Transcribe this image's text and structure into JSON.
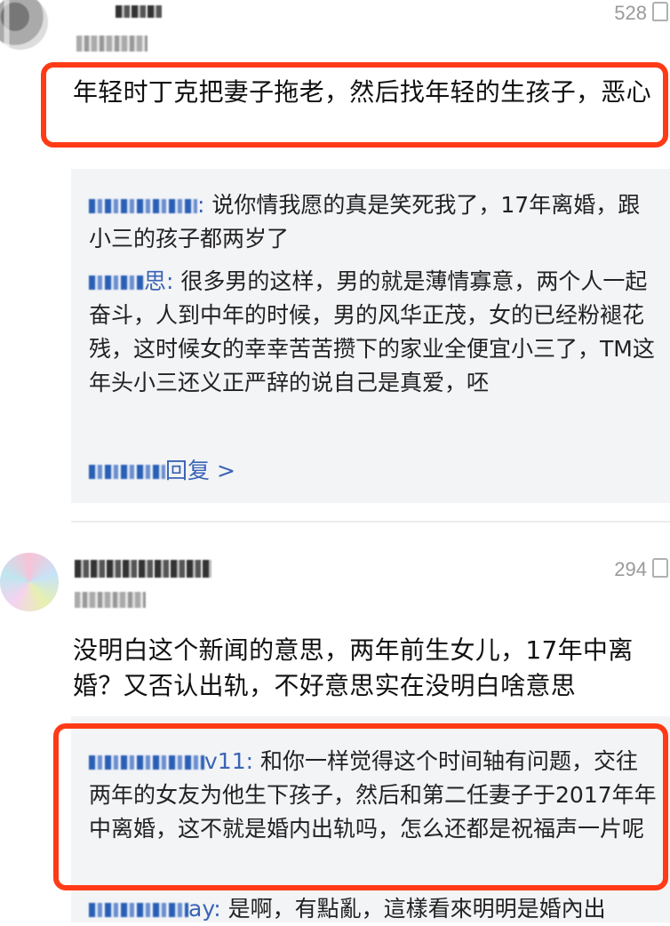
{
  "comments": [
    {
      "likes": "528",
      "text": "年轻时丁克把妻子拖老，然后找年轻的生孩子，恶心",
      "replies": [
        {
          "user_suffix": ":",
          "text": " 说你情我愿的真是笑死我了，17年离婚，跟小三的孩子都两岁了"
        },
        {
          "user_suffix": "思:",
          "text": " 很多男的这样，男的就是薄情寡意，两个人一起奋斗，人到中年的时候，男的风华正茂，女的已经粉褪花残，这时候女的幸幸苦苦攒下的家业全便宜小三了，TM这年头小三还义正严辞的说自己是真爱，呸"
        }
      ],
      "more_label": "回复 >"
    },
    {
      "likes": "294",
      "text": "没明白这个新闻的意思，两年前生女儿，17年中离婚？又否认出轨，不好意思实在没明白啥意思",
      "replies": [
        {
          "user_suffix": "v11:",
          "text": " 和你一样觉得这个时间轴有问题，交往两年的女友为他生下孩子，然后和第二任妻子于2017年年中离婚，这不就是婚内出轨吗，怎么还都是祝福声一片呢"
        },
        {
          "user_suffix": "ay:",
          "text": " 是啊，有點亂，這樣看來明明是婚內出"
        }
      ]
    }
  ],
  "colors": {
    "highlight_frame": "#ff3b17",
    "username": "#3a64b5",
    "reply_bg": "#f3f4f6"
  },
  "icons": {
    "like": "thumbs-up-icon"
  }
}
